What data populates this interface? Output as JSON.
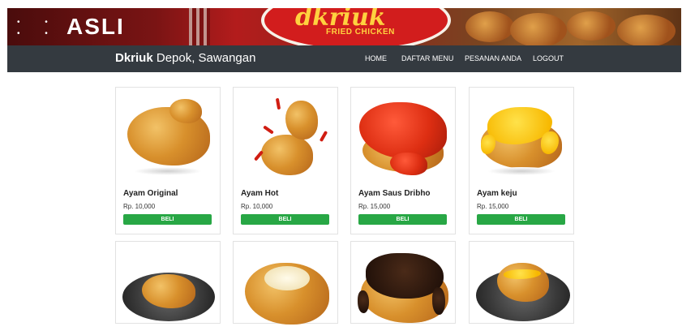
{
  "banner": {
    "headline": "ASLI",
    "logo_text": "dkriuk",
    "logo_subtitle": "FRIED CHICKEN"
  },
  "navbar": {
    "brand_bold": "Dkriuk",
    "brand_rest": " Depok, Sawangan",
    "links": [
      "HOME",
      "DAFTAR MENU",
      "PESANAN ANDA",
      "LOGOUT"
    ]
  },
  "products": [
    {
      "name": "Ayam Original",
      "price": "Rp. 10,000",
      "button": "BELI",
      "image": "fried-chicken-original"
    },
    {
      "name": "Ayam Hot",
      "price": "Rp. 10,000",
      "button": "BELI",
      "image": "fried-chicken-hot-with-chili"
    },
    {
      "name": "Ayam Saus Dribho",
      "price": "Rp. 15,000",
      "button": "BELI",
      "image": "fried-chicken-red-sauce"
    },
    {
      "name": "Ayam keju",
      "price": "Rp. 15,000",
      "button": "BELI",
      "image": "fried-chicken-cheese-sauce"
    }
  ],
  "products_row2_images": [
    "fried-chicken-on-dark-plate",
    "fried-chicken-white-sauce",
    "fried-chicken-chocolate-sauce",
    "fried-chicken-cheese-drizzle-plate"
  ]
}
